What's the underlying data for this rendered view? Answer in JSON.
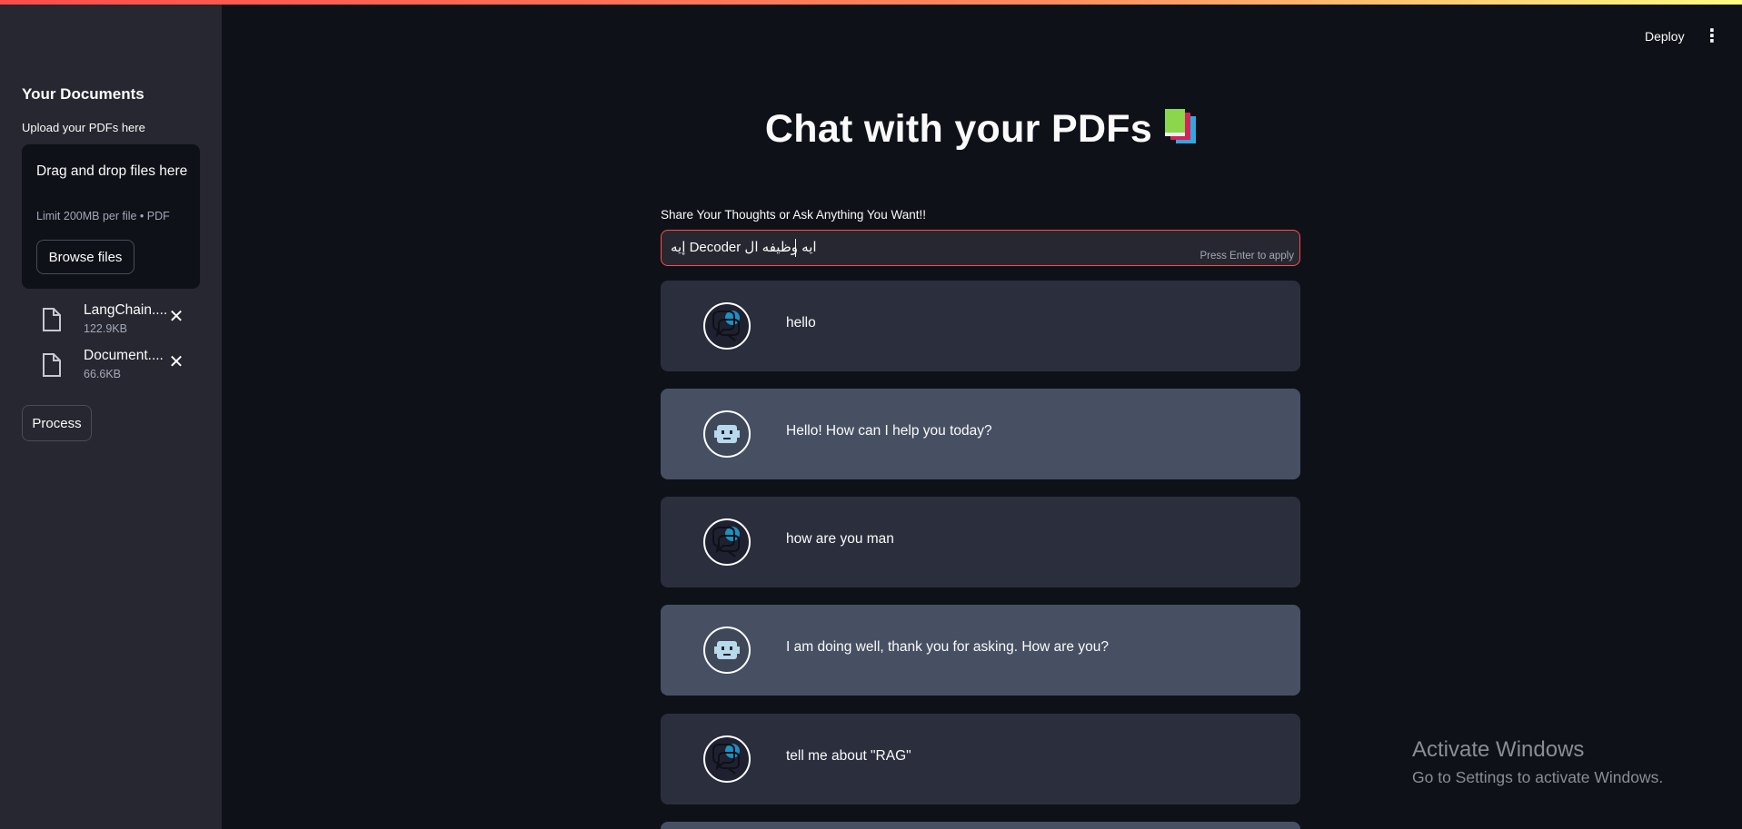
{
  "sidebar": {
    "title": "Your Documents",
    "uploader_label": "Upload your PDFs here",
    "dropzone": {
      "text": "Drag and drop files here",
      "limit": "Limit 200MB per file • PDF",
      "browse_label": "Browse files"
    },
    "files": [
      {
        "name": "LangChain....",
        "size": "122.9KB",
        "icon": "file-icon"
      },
      {
        "name": "Document....",
        "size": "66.6KB",
        "icon": "file-icon"
      }
    ],
    "process_label": "Process"
  },
  "header": {
    "deploy_label": "Deploy",
    "menu_icon": "kebab-menu-icon"
  },
  "main": {
    "title": "Chat with your PDFs",
    "title_emoji": "books-icon",
    "input": {
      "label": "Share Your Thoughts or Ask Anything You Want!!",
      "value": "ايه وظيفه ال Decoder إيه",
      "hint": "Press Enter to apply"
    },
    "messages": [
      {
        "role": "user",
        "text": "hello"
      },
      {
        "role": "bot",
        "text": "Hello! How can I help you today?"
      },
      {
        "role": "user",
        "text": "how are you man"
      },
      {
        "role": "bot",
        "text": "I am doing well, thank you for asking. How are you?"
      },
      {
        "role": "user",
        "text": "tell me about \"RAG\""
      }
    ]
  },
  "watermark": {
    "title": "Activate Windows",
    "subtitle": "Go to Settings to activate Windows."
  },
  "colors": {
    "accent": "#ff4b4b",
    "background": "#0e1117",
    "sidebar": "#262730",
    "user_message": "#2b2f3d",
    "bot_message": "#475063"
  }
}
